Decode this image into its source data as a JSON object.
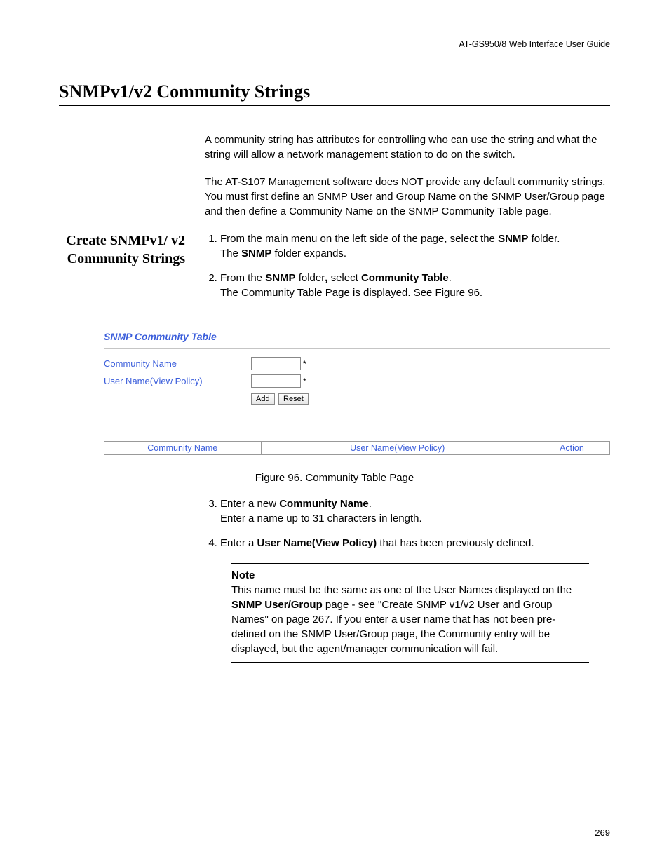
{
  "doc_header": "AT-GS950/8  Web Interface User Guide",
  "main_title": "SNMPv1/v2 Community Strings",
  "intro": {
    "p1": "A community string has attributes for controlling who can use the string and what the string will allow a network management station to do on the switch.",
    "p2": "The AT-S107 Management software does NOT provide any default community strings. You must first define an SNMP User and Group Name on the SNMP User/Group page and then define a Community Name on the SNMP Community Table page."
  },
  "side_heading": "Create SNMPv1/ v2 Community Strings",
  "steps": {
    "s1a": "From the main menu on the left side of the page, select the ",
    "s1b_bold": "SNMP",
    "s1c": " folder.",
    "s1d_prefix": "The ",
    "s1d_bold": "SNMP",
    "s1d_suffix": " folder expands.",
    "s2a": "From the ",
    "s2a_bold": "SNMP",
    "s2b": " folder",
    "s2b_bold2": ",",
    "s2c": " select ",
    "s2c_bold": "Community Table",
    "s2d": ".",
    "s2e": "The Community Table Page is displayed. See Figure 96.",
    "s3a": "Enter a new ",
    "s3a_bold": "Community Name",
    "s3b": ".",
    "s3c": "Enter a name up to 31 characters in length.",
    "s4a": "Enter a ",
    "s4a_bold": "User Name(View Policy)",
    "s4b": " that has been previously defined."
  },
  "figure": {
    "title": "SNMP Community Table",
    "label_community": "Community Name",
    "label_user": "User Name(View Policy)",
    "btn_add": "Add",
    "btn_reset": "Reset",
    "col_community": "Community Name",
    "col_user": "User Name(View Policy)",
    "col_action": "Action",
    "caption": "Figure 96. Community Table Page"
  },
  "note": {
    "label": "Note",
    "pre": "This name must be the same as one of the User Names displayed on the ",
    "bold": "SNMP User/Group",
    "post": " page - see \"Create SNMP v1/v2 User and Group Names\" on page 267. If you enter a user name that has not been pre-defined on the SNMP User/Group page, the Community entry will be displayed, but the agent/manager communication will fail."
  },
  "page_number": "269"
}
